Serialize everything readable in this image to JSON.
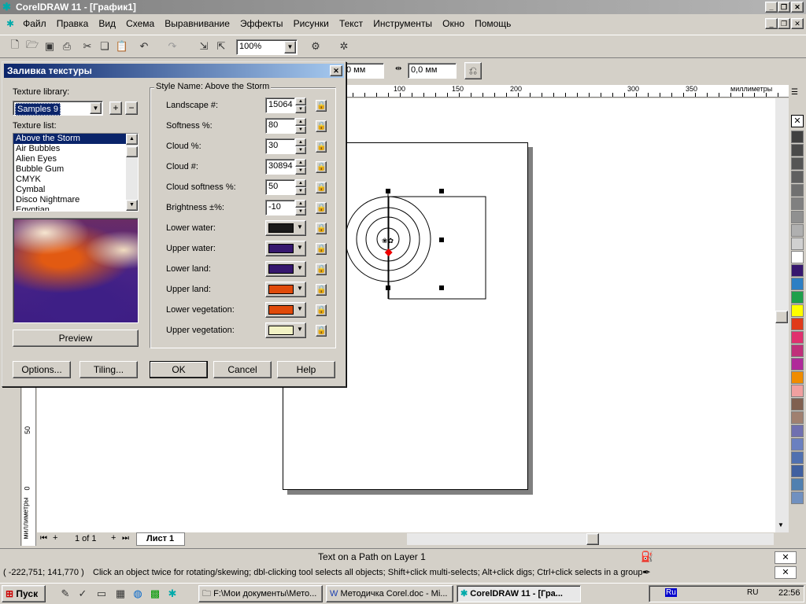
{
  "app": {
    "title": "CorelDRAW 11 - [График1]",
    "menu": [
      "Файл",
      "Правка",
      "Вид",
      "Схема",
      "Выравнивание",
      "Эффекты",
      "Рисунки",
      "Текст",
      "Инструменты",
      "Окно",
      "Помощь"
    ],
    "zoom": "100%",
    "prop_y": "0 мм",
    "prop_offset": "0,0 мм",
    "ruler_unit": "миллиметры",
    "ruler_ticks": [
      "100",
      "150",
      "200",
      "300",
      "350"
    ],
    "vruler_ticks": [
      "50",
      "0"
    ],
    "page_nav": "1 of 1",
    "page_tab": "Лист 1",
    "status_object": "Text on a Path on Layer 1",
    "status_coords": "( -222,751; 141,770 )",
    "status_hint": "Click an object twice for rotating/skewing; dbl-clicking tool selects all objects; Shift+click multi-selects; Alt+click digs; Ctrl+click selects in a group"
  },
  "dialog": {
    "title": "Заливка текстуры",
    "texture_library_label": "Texture library:",
    "texture_library_value": "Samples 9",
    "texture_list_label": "Texture list:",
    "texture_list": [
      "Above the Storm",
      "Air Bubbles",
      "Alien Eyes",
      "Bubble Gum",
      "CMYK",
      "Cymbal",
      "Disco Nightmare",
      "Egyptian"
    ],
    "style_name": "Style Name: Above the Storm",
    "params": [
      {
        "label": "Landscape #:",
        "value": "15064"
      },
      {
        "label": "Softness %:",
        "value": "80"
      },
      {
        "label": "Cloud %:",
        "value": "30"
      },
      {
        "label": "Cloud #:",
        "value": "30894"
      },
      {
        "label": "Cloud softness %:",
        "value": "50"
      },
      {
        "label": "Brightness ±%:",
        "value": "-10"
      }
    ],
    "colors": [
      {
        "label": "Lower water:",
        "color": "#1a1a1a"
      },
      {
        "label": "Upper water:",
        "color": "#36176e"
      },
      {
        "label": "Lower land:",
        "color": "#36176e"
      },
      {
        "label": "Upper land:",
        "color": "#e04a0a"
      },
      {
        "label": "Lower vegetation:",
        "color": "#e04a0a"
      },
      {
        "label": "Upper vegetation:",
        "color": "#f2f2c4"
      }
    ],
    "preview_label": "Preview",
    "options_label": "Options...",
    "tiling_label": "Tiling...",
    "ok_label": "OK",
    "cancel_label": "Cancel",
    "help_label": "Help"
  },
  "palette": [
    "#404040",
    "#4a4a4a",
    "#555555",
    "#606060",
    "#707070",
    "#808080",
    "#909090",
    "#b0b0b0",
    "#d0d0d0",
    "#ffffff",
    "#36176e",
    "#2d7fc4",
    "#1ea04b",
    "#ffff00",
    "#e03a1a",
    "#e0306e",
    "#c0307a",
    "#b02a9a",
    "#f08c00",
    "#f0a0a0",
    "#806050",
    "#a08070",
    "#7070b0",
    "#6a80c0",
    "#5070b0",
    "#4060a0",
    "#5080b0",
    "#7090c0"
  ],
  "taskbar": {
    "start_label": "Пуск",
    "tasks": [
      "F:\\Мои документы\\Мето...",
      "Методичка Corel.doc - Mi...",
      "CorelDRAW 11 - [Гра..."
    ],
    "tray_lang": "Ru",
    "tray_lang2": "RU",
    "clock": "22:56"
  }
}
